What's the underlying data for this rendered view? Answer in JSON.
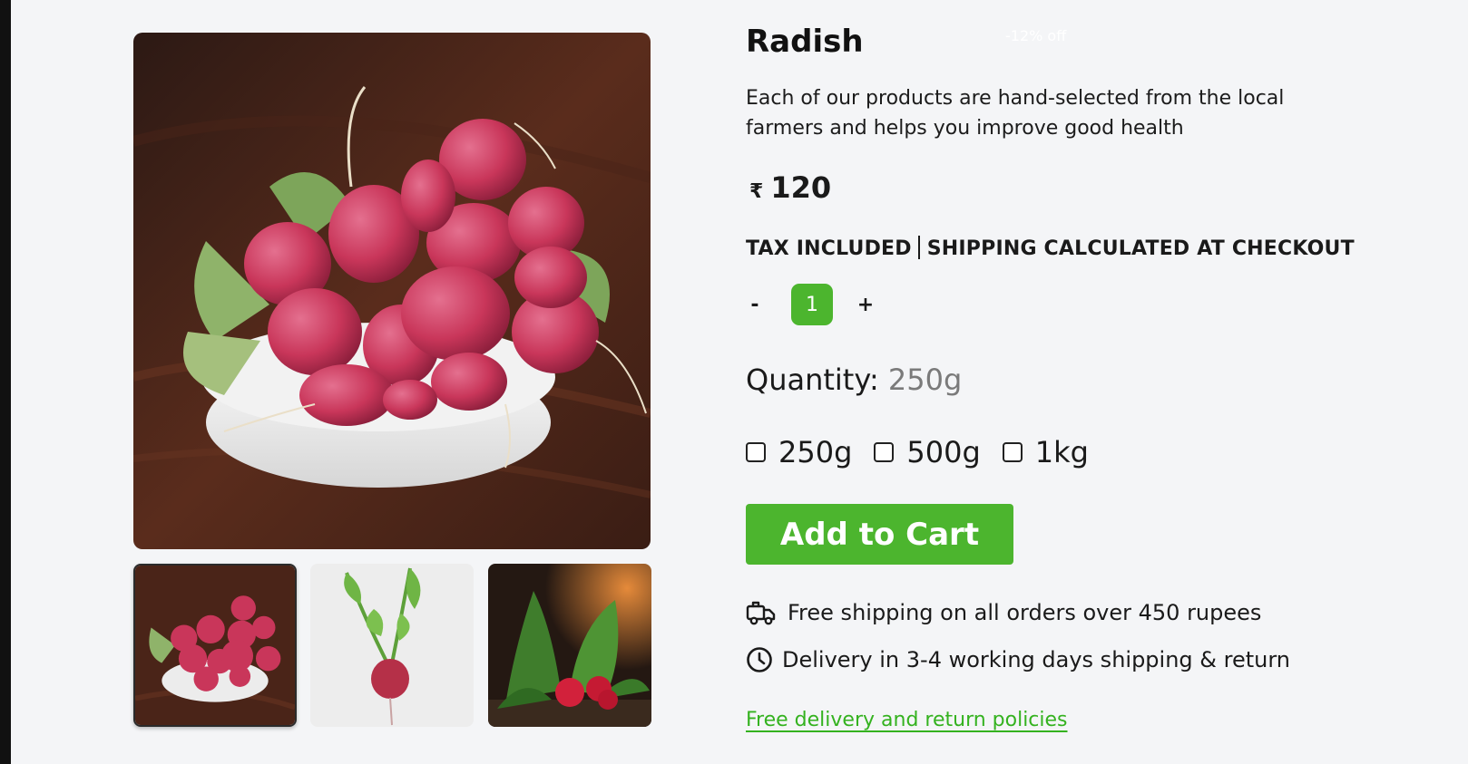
{
  "product": {
    "title": "Radish",
    "discount_badge": "-12% off",
    "description": "Each of our products are hand-selected from the local farmers and helps you improve good health",
    "currency_symbol": "₹",
    "price": "120",
    "tax_note": "TAX INCLUDED",
    "shipping_note": "SHIPPING CALCULATED AT CHECKOUT"
  },
  "stepper": {
    "minus_label": "-",
    "plus_label": "+",
    "value": "1"
  },
  "quantity": {
    "label": "Quantity:",
    "selected": "250g",
    "options": [
      "250g",
      "500g",
      "1kg"
    ]
  },
  "cart": {
    "button_label": "Add to Cart"
  },
  "perks": [
    {
      "icon": "delivery-truck-icon",
      "text": "Free shipping on all orders over 450 rupees"
    },
    {
      "icon": "clock-icon",
      "text": "Delivery in 3-4 working days shipping & return"
    }
  ],
  "policy_link": "Free delivery and return policies",
  "colors": {
    "accent_green": "#4cb52e",
    "link_green": "#34b21f",
    "background": "#f4f5f7"
  },
  "gallery": {
    "main_image": "radishes-in-white-bowl",
    "thumbnails": [
      "radishes-in-white-bowl",
      "single-radish-on-white",
      "radishes-with-leaves-dark"
    ]
  }
}
